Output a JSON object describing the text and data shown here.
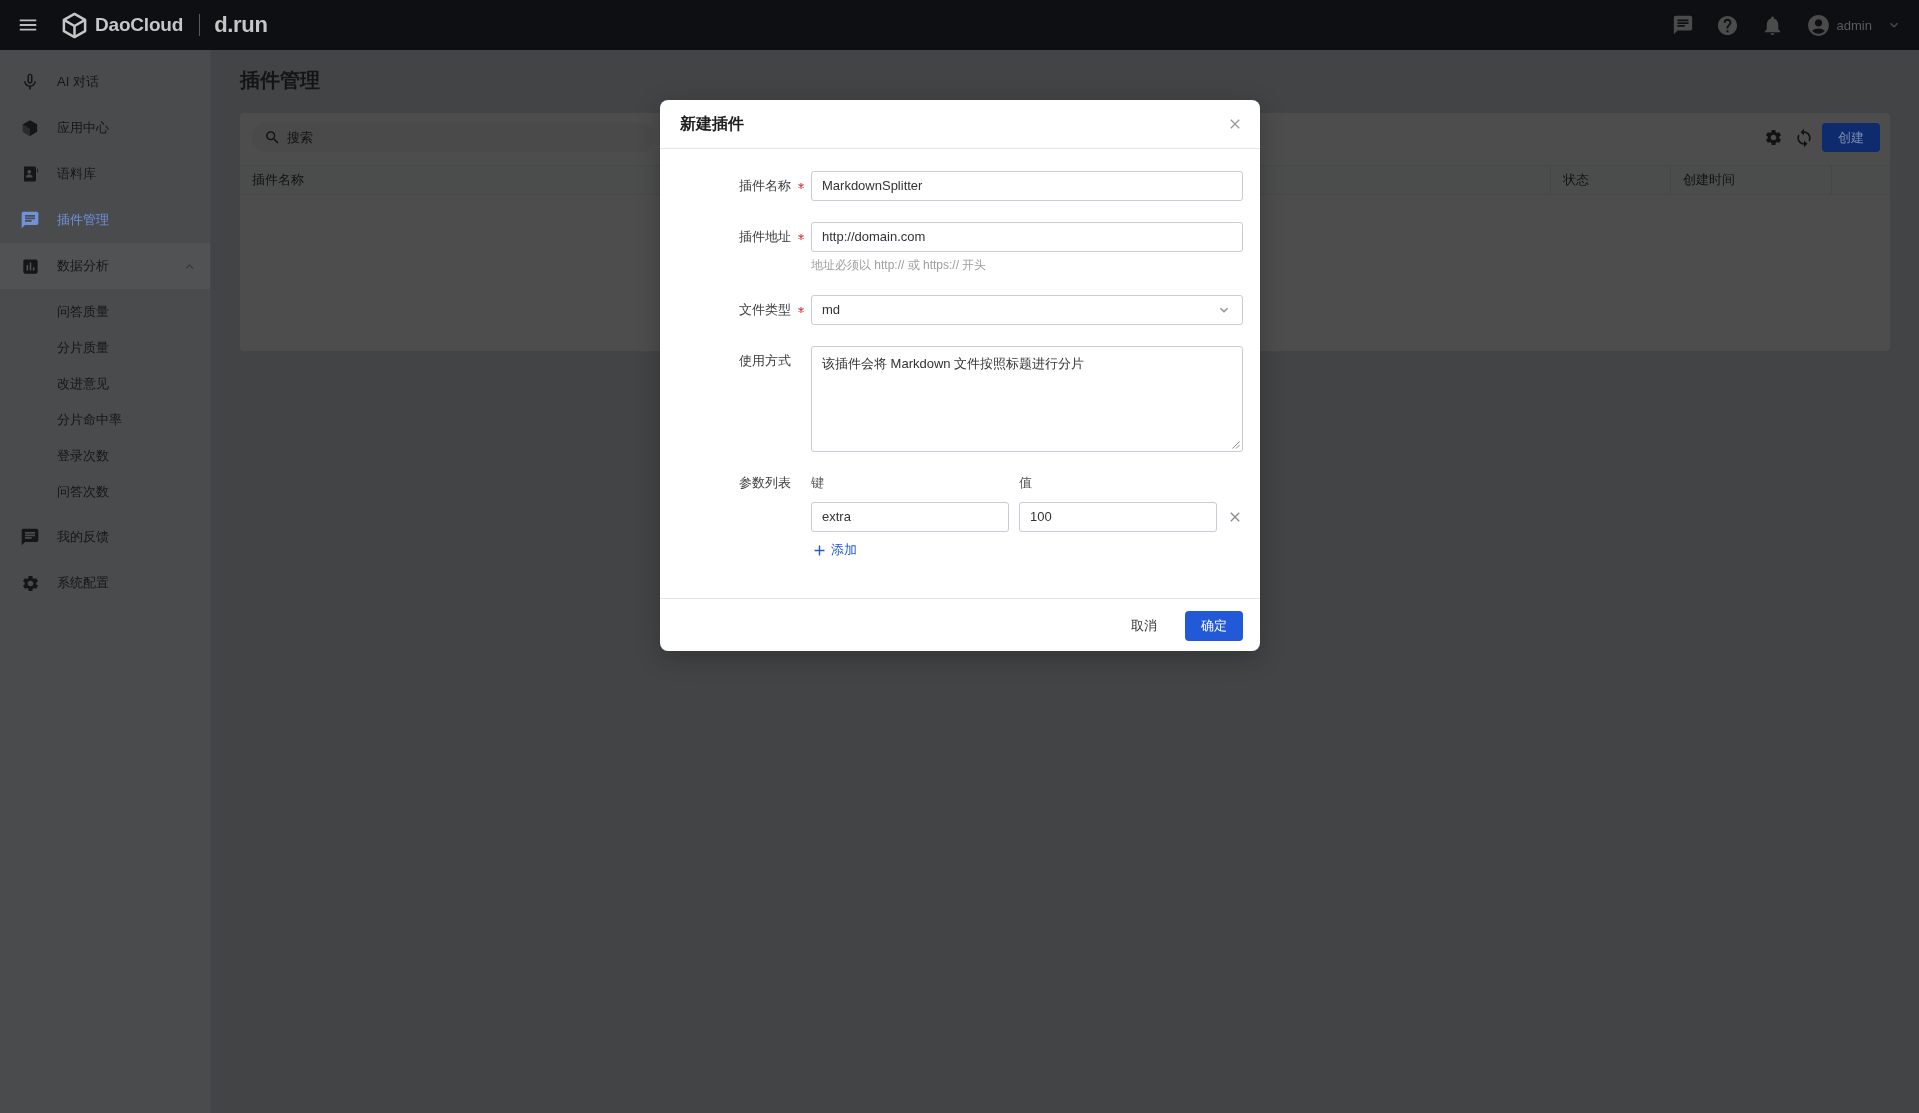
{
  "top_bar": {
    "brand": "DaoCloud",
    "product": "d.run",
    "user": "admin"
  },
  "sidebar": {
    "items": [
      {
        "label": "AI 对话",
        "selected": false
      },
      {
        "label": "应用中心",
        "selected": false
      },
      {
        "label": "语料库",
        "selected": false
      },
      {
        "label": "插件管理",
        "selected": true
      },
      {
        "label": "数据分析",
        "selected": false,
        "expanded": true,
        "children": [
          {
            "label": "问答质量",
            "selected": false
          },
          {
            "label": "分片质量",
            "selected": false
          },
          {
            "label": "改进意见",
            "selected": false
          },
          {
            "label": "分片命中率",
            "selected": false
          },
          {
            "label": "登录次数",
            "selected": false
          },
          {
            "label": "问答次数",
            "selected": false
          }
        ]
      },
      {
        "label": "我的反馈",
        "selected": false
      },
      {
        "label": "系统配置",
        "selected": false
      }
    ]
  },
  "page": {
    "title": "插件管理",
    "search": {
      "placeholder": "搜索"
    },
    "create_button": "创建",
    "table": {
      "columns": [
        "插件名称",
        "状态",
        "创建时间"
      ]
    }
  },
  "dialog": {
    "title": "新建插件",
    "fields": [
      {
        "kind": "input",
        "label": "插件名称",
        "required": true,
        "value": "MarkdownSplitter"
      },
      {
        "kind": "input",
        "label": "插件地址",
        "required": true,
        "value": "http://domain.com",
        "help": "地址必须以 http:// 或 https:// 开头"
      },
      {
        "kind": "select",
        "label": "文件类型",
        "required": true,
        "value": "md"
      },
      {
        "kind": "textarea",
        "label": "使用方式",
        "required": false,
        "value": "该插件会将 Markdown 文件按照标题进行分片"
      },
      {
        "kind": "params",
        "label": "参数列表",
        "required": false,
        "key_label": "键",
        "value_label": "值",
        "rows": [
          {
            "key": "extra",
            "value": "100"
          }
        ],
        "add_label": "添加"
      }
    ],
    "buttons": [
      {
        "label": "取消",
        "kind": "default"
      },
      {
        "label": "确定",
        "kind": "primary"
      }
    ]
  }
}
